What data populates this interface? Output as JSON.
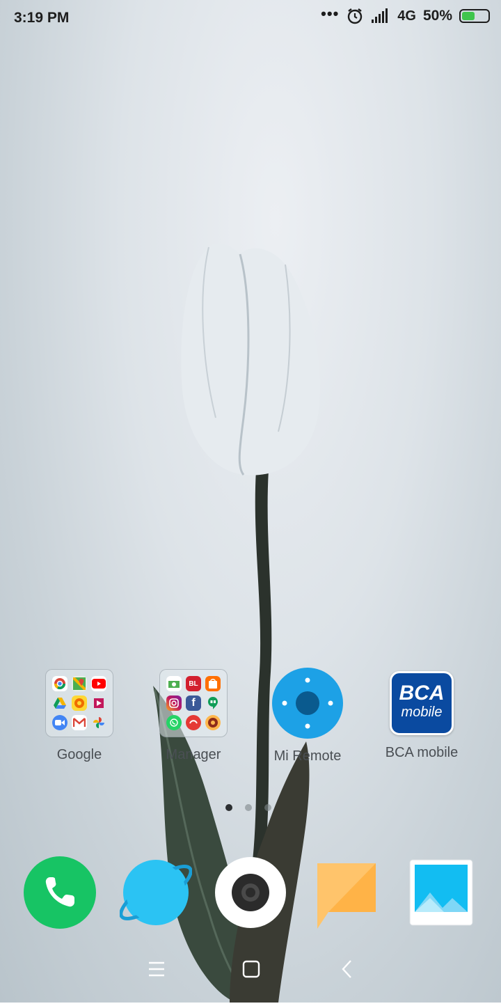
{
  "status_bar": {
    "time": "3:19 PM",
    "more_icon": "more-dots-icon",
    "alarm_icon": "alarm-icon",
    "signal_icon": "signal-icon",
    "network": "4G",
    "battery": "50%",
    "battery_level": 0.5,
    "battery_color": "#3fc54c"
  },
  "home_apps": [
    {
      "label": "Google",
      "kind": "folder"
    },
    {
      "label": "Manager",
      "kind": "folder"
    },
    {
      "label": "Mi Remote",
      "kind": "app",
      "color": "#1da1e6"
    },
    {
      "label": "BCA mobile",
      "kind": "app",
      "color": "#0a4aa0"
    }
  ],
  "bca_logo": {
    "line1": "BCA",
    "line2": "mobile"
  },
  "page_indicator": {
    "count": 3,
    "active": 1
  },
  "dock": [
    {
      "icon": "phone-icon",
      "color": "#17c464"
    },
    {
      "icon": "browser-icon",
      "color": "#2bc3f3"
    },
    {
      "icon": "camera-icon",
      "color": "#ffffff"
    },
    {
      "icon": "messages-icon",
      "color": "#ffc46b"
    },
    {
      "icon": "gallery-icon",
      "color": "#12bdf2"
    }
  ],
  "nav_bar": {
    "menu_icon": "menu-icon",
    "home_icon": "home-icon",
    "back_icon": "back-icon"
  }
}
